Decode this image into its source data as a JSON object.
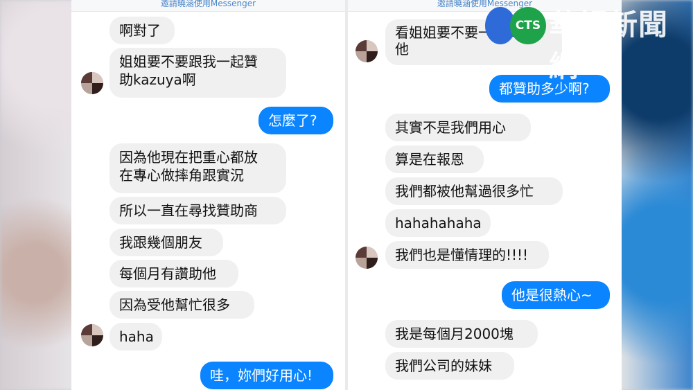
{
  "header_text": "邀請曉涵使用Messenger",
  "watermark": {
    "badge": "CTS",
    "name": "華視新聞網"
  },
  "left_panel": {
    "messages": [
      {
        "dir": "in",
        "text": "啊對了"
      },
      {
        "dir": "in",
        "text": "姐姐要不要跟我一起贊\n助kazuya啊"
      },
      {
        "dir": "out",
        "text": "怎麼了?"
      },
      {
        "dir": "in",
        "text": "因為他現在把重心都放\n在專心做摔角跟實況"
      },
      {
        "dir": "in",
        "text": "所以一直在尋找贊助商"
      },
      {
        "dir": "in",
        "text": "我跟幾個朋友"
      },
      {
        "dir": "in",
        "text": "每個月有讚助他"
      },
      {
        "dir": "in",
        "text": "因為受他幫忙很多"
      },
      {
        "dir": "in",
        "text": "haha"
      },
      {
        "dir": "out",
        "text": "哇，妳們好用心!"
      }
    ]
  },
  "right_panel": {
    "messages": [
      {
        "dir": "in",
        "text": "看姐姐要不要一起贊助\n他"
      },
      {
        "dir": "out",
        "text": "都贊助多少啊?"
      },
      {
        "dir": "in",
        "text": "其實不是我們用心"
      },
      {
        "dir": "in",
        "text": "算是在報恩"
      },
      {
        "dir": "in",
        "text": "我們都被他幫過很多忙"
      },
      {
        "dir": "in",
        "text": "hahahahaha"
      },
      {
        "dir": "in",
        "text": "我們也是懂情理的!!!!"
      },
      {
        "dir": "out",
        "text": "他是很熱心~"
      },
      {
        "dir": "in",
        "text": "我是每個月2000塊"
      },
      {
        "dir": "in",
        "text": "我們公司的妹妹"
      }
    ]
  },
  "colors": {
    "incoming": "#f0f0f0",
    "outgoing": "#0a84ff",
    "link": "#4a86c7"
  }
}
